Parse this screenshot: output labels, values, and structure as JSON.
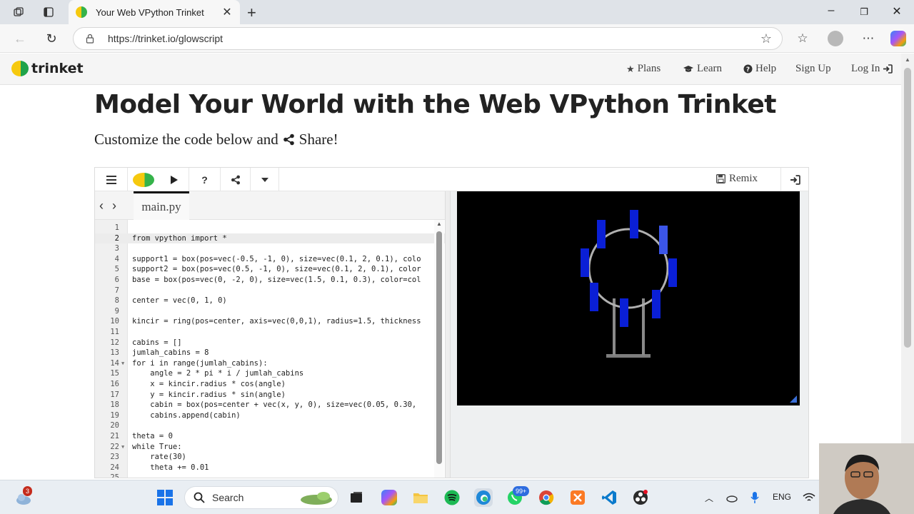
{
  "browser": {
    "tab_title": "Your Web VPython Trinket",
    "url": "https://trinket.io/glowscript"
  },
  "site_nav": {
    "logo_text": "trinket",
    "links": [
      {
        "label": "Plans",
        "icon": "star-icon"
      },
      {
        "label": "Learn",
        "icon": "graduation-cap-icon"
      },
      {
        "label": "Help",
        "icon": "question-circle-icon"
      },
      {
        "label": "Sign Up",
        "icon": ""
      },
      {
        "label": "Log In",
        "icon": "sign-in-icon"
      }
    ]
  },
  "page": {
    "title": "Model Your World with the Web VPython Trinket",
    "subtitle_before": "Customize the code below and",
    "subtitle_link": "Share!"
  },
  "trinket": {
    "remix_label": "Remix",
    "file_tab": "main.py",
    "code_lines": [
      {
        "n": "1",
        "text": ""
      },
      {
        "n": "2",
        "text": "from vpython import *"
      },
      {
        "n": "3",
        "text": ""
      },
      {
        "n": "4",
        "text": "support1 = box(pos=vec(-0.5, -1, 0), size=vec(0.1, 2, 0.1), colo"
      },
      {
        "n": "5",
        "text": "support2 = box(pos=vec(0.5, -1, 0), size=vec(0.1, 2, 0.1), color"
      },
      {
        "n": "6",
        "text": "base = box(pos=vec(0, -2, 0), size=vec(1.5, 0.1, 0.3), color=col"
      },
      {
        "n": "7",
        "text": ""
      },
      {
        "n": "8",
        "text": "center = vec(0, 1, 0)"
      },
      {
        "n": "9",
        "text": ""
      },
      {
        "n": "10",
        "text": "kincir = ring(pos=center, axis=vec(0,0,1), radius=1.5, thickness"
      },
      {
        "n": "11",
        "text": ""
      },
      {
        "n": "12",
        "text": "cabins = []"
      },
      {
        "n": "13",
        "text": "jumlah_cabins = 8"
      },
      {
        "n": "14",
        "text": "for i in range(jumlah_cabins):"
      },
      {
        "n": "15",
        "text": "    angle = 2 * pi * i / jumlah_cabins"
      },
      {
        "n": "16",
        "text": "    x = kincir.radius * cos(angle)"
      },
      {
        "n": "17",
        "text": "    y = kincir.radius * sin(angle)"
      },
      {
        "n": "18",
        "text": "    cabin = box(pos=center + vec(x, y, 0), size=vec(0.05, 0.30,"
      },
      {
        "n": "19",
        "text": "    cabins.append(cabin)"
      },
      {
        "n": "20",
        "text": ""
      },
      {
        "n": "21",
        "text": "theta = 0"
      },
      {
        "n": "22",
        "text": "while True:"
      },
      {
        "n": "23",
        "text": "    rate(30)"
      },
      {
        "n": "24",
        "text": "    theta += 0.01"
      },
      {
        "n": "25",
        "text": ""
      }
    ]
  },
  "taskbar": {
    "search_placeholder": "Search",
    "weather_badge": "3",
    "whatsapp_badge": "99+",
    "language": "ENG"
  },
  "colors": {
    "cabin_blue": "#0a1fd6",
    "canvas_bg": "#000000",
    "ring_gray": "#9a9a9a"
  }
}
